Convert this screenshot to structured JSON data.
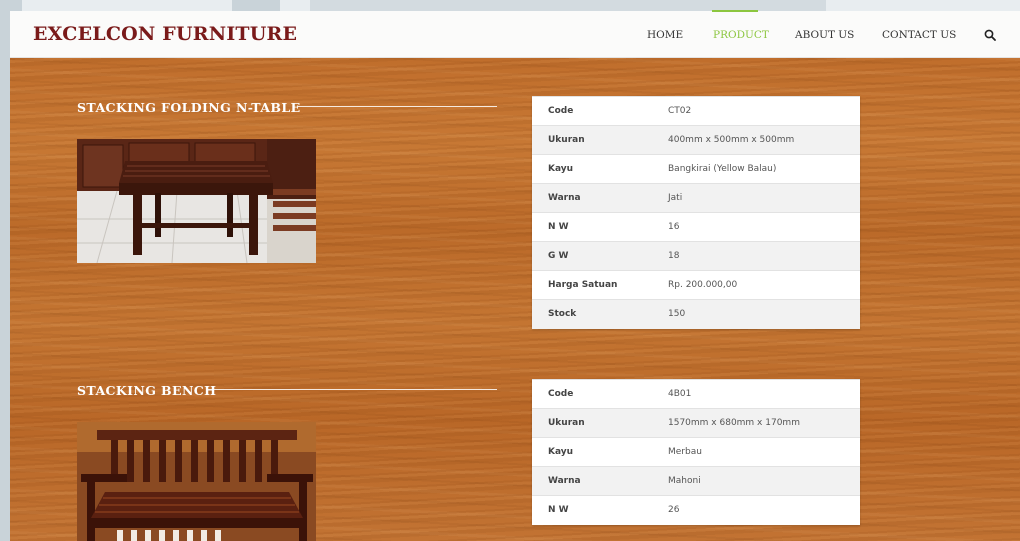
{
  "header": {
    "brand": "EXCELCON FURNITURE",
    "nav": [
      {
        "label": "HOME",
        "active": false
      },
      {
        "label": "PRODUCT",
        "active": true
      },
      {
        "label": "ABOUT US",
        "active": false
      },
      {
        "label": "CONTACT US",
        "active": false
      }
    ],
    "search_icon": "search-icon",
    "accent_color": "#8cc63f",
    "brand_color": "#7a1a1a"
  },
  "products": [
    {
      "title": "STACKING FOLDING N-TABLE",
      "specs": [
        {
          "label": "Code",
          "value": "CT02"
        },
        {
          "label": "Ukuran",
          "value": "400mm x 500mm x 500mm"
        },
        {
          "label": "Kayu",
          "value": "Bangkirai (Yellow Balau)"
        },
        {
          "label": "Warna",
          "value": "Jati"
        },
        {
          "label": "N W",
          "value": "16"
        },
        {
          "label": "G W",
          "value": "18"
        },
        {
          "label": "Harga Satuan",
          "value": "Rp. 200.000,00"
        },
        {
          "label": "Stock",
          "value": "150"
        }
      ]
    },
    {
      "title": "STACKING BENCH",
      "specs": [
        {
          "label": "Code",
          "value": "4B01"
        },
        {
          "label": "Ukuran",
          "value": "1570mm x 680mm x 170mm"
        },
        {
          "label": "Kayu",
          "value": "Merbau"
        },
        {
          "label": "Warna",
          "value": "Mahoni"
        },
        {
          "label": "N W",
          "value": "26"
        }
      ]
    }
  ]
}
